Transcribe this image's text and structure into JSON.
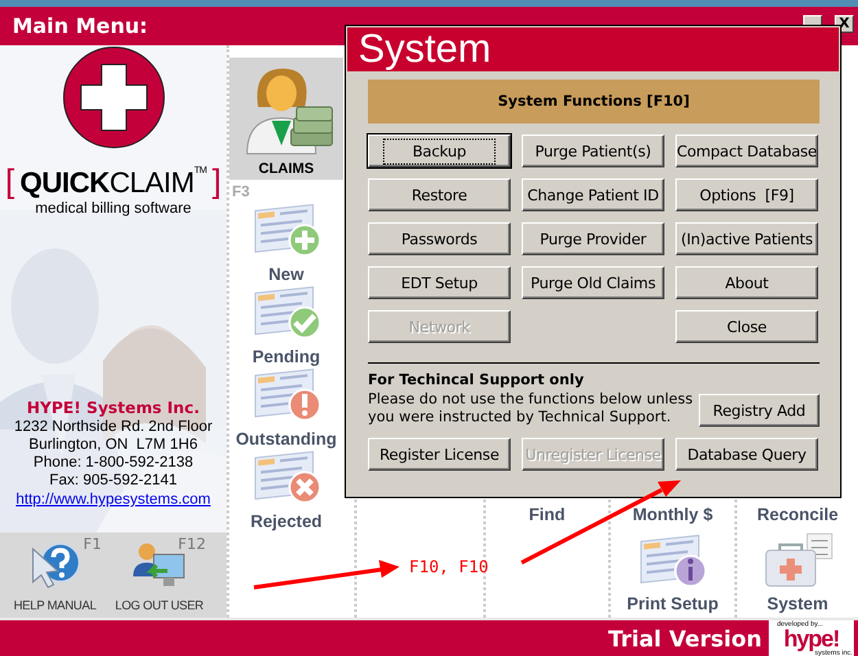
{
  "window": {
    "title": "Main Menu:",
    "close_button": "X"
  },
  "logo": {
    "bracket_left": "[",
    "name": "**QUICK**CLAIM$^{TM}$",
    "bracket_right": "]",
    "tagline": "medical billing software"
  },
  "company": {
    "name": "HYPE! Systems Inc.",
    "address_lines": [
      "1232 Northside Rd. 2nd Floor",
      "Burlington, ON  L7M 1H6",
      "Phone: 1-800-592-2138",
      "Fax: 905-592-2141"
    ],
    "link": "http://www.hypesystems.com"
  },
  "quick_tools": [
    {
      "kind": "help",
      "label": "HELP MANUAL",
      "key": "F1"
    },
    {
      "kind": "logout",
      "label": "LOG OUT USER",
      "key": "F12"
    }
  ],
  "claims": {
    "label": "CLAIMS",
    "key": "F3",
    "selected": true,
    "items": [
      {
        "kind": "new",
        "label": "New"
      },
      {
        "kind": "pending",
        "label": "Pending"
      },
      {
        "kind": "outstanding",
        "label": "Outstanding"
      },
      {
        "kind": "rejected",
        "label": "Rejected"
      }
    ]
  },
  "tiles": {
    "row_1": [
      {
        "label": "Find"
      },
      {
        "label": "Monthly $"
      },
      {
        "label": "Reconcile"
      }
    ],
    "row_2": [
      {
        "kind": "print-setup",
        "label": "Print Setup"
      },
      {
        "kind": "system",
        "label": "System"
      }
    ]
  },
  "dialog": {
    "title": "System",
    "header": "System Functions [F10]",
    "columns": [
      [
        {
          "label": "Backup",
          "focused": true,
          "disabled": false
        },
        {
          "label": "Restore",
          "focused": false,
          "disabled": false
        },
        {
          "label": "Passwords",
          "focused": false,
          "disabled": false
        },
        {
          "label": "EDT Setup",
          "focused": false,
          "disabled": false
        },
        {
          "label": "Network",
          "focused": false,
          "disabled": true
        }
      ],
      [
        {
          "label": "Purge Patient(s)",
          "focused": false,
          "disabled": false
        },
        {
          "label": "Change Patient ID",
          "focused": false,
          "disabled": false
        },
        {
          "label": "Purge Provider",
          "focused": false,
          "disabled": false
        },
        {
          "label": "Purge Old Claims",
          "focused": false,
          "disabled": false
        }
      ],
      [
        {
          "label": "Compact Database",
          "focused": false,
          "disabled": false
        },
        {
          "label": "Options  [F9]",
          "focused": false,
          "disabled": false
        },
        {
          "label": "(In)active Patients",
          "focused": false,
          "disabled": false
        },
        {
          "label": "About",
          "focused": false,
          "disabled": false
        },
        {
          "label": "Close",
          "focused": false,
          "disabled": false
        }
      ]
    ],
    "support": {
      "heading": "For Techincal Support only",
      "note_lines": [
        "Please do not use the functions below unless",
        "you were instructed by Technical Support."
      ],
      "registry_button": {
        "label": "Registry Add",
        "disabled": false
      },
      "buttons": [
        {
          "label": "Register License",
          "disabled": false
        },
        {
          "label": "Unregister License",
          "disabled": true
        },
        {
          "label": "Database Query",
          "disabled": false
        }
      ]
    }
  },
  "annotation": {
    "text": "F10, F10"
  },
  "footer": {
    "status": "Trial Version",
    "brand": {
      "top": "developed by...",
      "name": "hype!",
      "bottom": "systems inc."
    }
  }
}
